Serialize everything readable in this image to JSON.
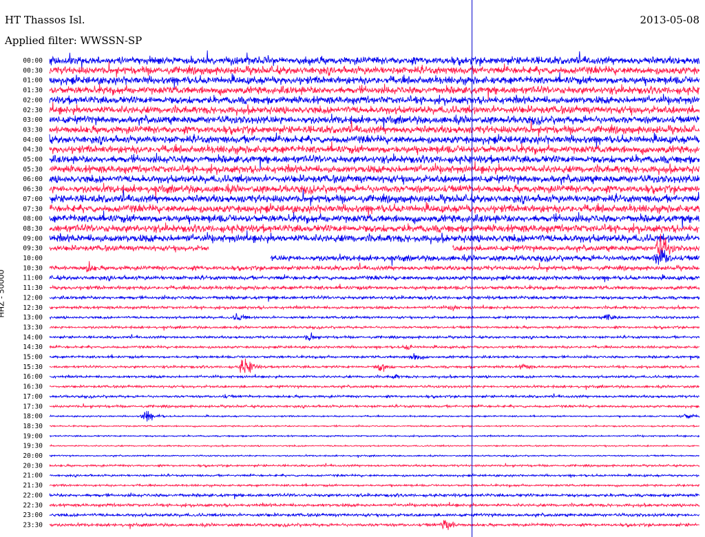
{
  "header": {
    "station": "HT Thassos Isl.",
    "date": "2013-05-08",
    "filter_prefix": "Applied filter:",
    "filter_name": "WWSSN-SP"
  },
  "colors": {
    "trace_a": "#0000ee",
    "trace_b": "#ff1a4a",
    "marker": "#0000cc",
    "text": "#000000"
  },
  "chart_data": {
    "type": "helicorder",
    "title": "HT Thassos Isl.",
    "date": "2013-05-08",
    "filter": "WWSSN-SP",
    "ylabel": "HHZ - 50000",
    "xlabel": "",
    "row_interval_minutes": 30,
    "rows": [
      "00:00",
      "00:30",
      "01:00",
      "01:30",
      "02:00",
      "02:30",
      "03:00",
      "03:30",
      "04:00",
      "04:30",
      "05:00",
      "05:30",
      "06:00",
      "06:30",
      "07:00",
      "07:30",
      "08:00",
      "08:30",
      "09:00",
      "09:30",
      "10:00",
      "10:30",
      "11:00",
      "11:30",
      "12:00",
      "12:30",
      "13:00",
      "13:30",
      "14:00",
      "14:30",
      "15:00",
      "15:30",
      "16:00",
      "16:30",
      "17:00",
      "17:30",
      "18:00",
      "18:30",
      "19:00",
      "19:30",
      "20:00",
      "20:30",
      "21:00",
      "21:30",
      "22:00",
      "22:30",
      "23:00",
      "23:30"
    ],
    "trace_colors": [
      "#0000ee",
      "#ff1a4a"
    ],
    "current_time_fraction": 0.65
  }
}
